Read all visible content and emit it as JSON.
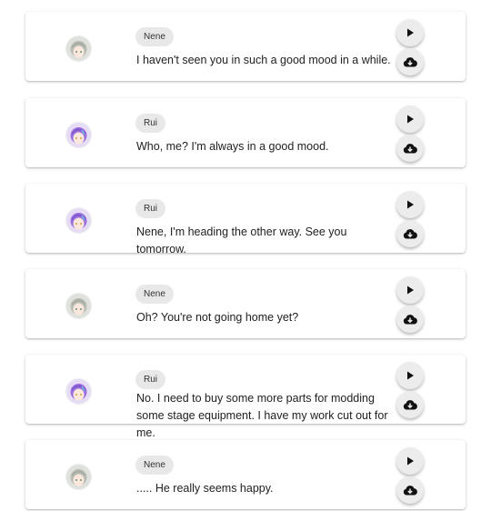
{
  "messages": [
    {
      "speaker": "Nene",
      "character": "nene",
      "text": "I haven't seen you in such a good mood in a while."
    },
    {
      "speaker": "Rui",
      "character": "rui",
      "text": "Who, me? I'm always in a good mood."
    },
    {
      "speaker": "Rui",
      "character": "rui",
      "text": "Nene, I'm heading the other way. See you tomorrow."
    },
    {
      "speaker": "Nene",
      "character": "nene",
      "text": "Oh? You're not going home yet?"
    },
    {
      "speaker": "Rui",
      "character": "rui",
      "text": "No. I need to buy some more parts for modding some stage equipment. I have my work cut out for me."
    },
    {
      "speaker": "Nene",
      "character": "nene",
      "text": "..... He really seems happy."
    }
  ],
  "icons": {
    "play": "play-icon",
    "download": "cloud-download-icon"
  },
  "colors": {
    "nene_hair": "#b7bcb4",
    "rui_hair": "#9b6fe0",
    "button_bg": "#ececec",
    "chip_bg": "#e8e8e8"
  }
}
